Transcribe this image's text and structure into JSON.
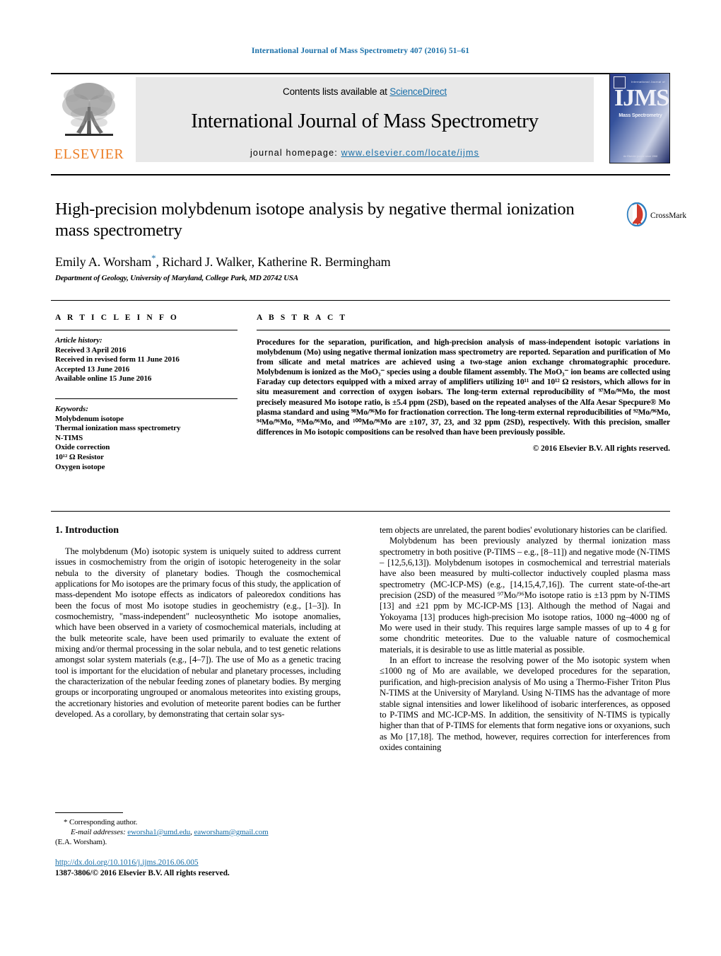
{
  "running_head": "International Journal of Mass Spectrometry 407 (2016) 51–61",
  "masthead": {
    "contents_prefix": "Contents lists available at ",
    "sciencedirect": "ScienceDirect",
    "journal_title": "International Journal of Mass Spectrometry",
    "homepage_label": "journal homepage: ",
    "homepage_url": "www.elsevier.com/locate/ijms",
    "publisher": "ELSEVIER",
    "cover": {
      "acronym": "IJMS",
      "subtitle": "Mass Spectrometry",
      "top_caption": "International Journal of",
      "bottom_caption": "An Elsevier journal since 1968"
    }
  },
  "article": {
    "title": "High-precision molybdenum isotope analysis by negative thermal ionization mass spectrometry",
    "authors": "Emily A. Worsham, Richard J. Walker, Katherine R. Bermingham",
    "author_names": [
      "Emily A. Worsham",
      "Richard J. Walker",
      "Katherine R. Bermingham"
    ],
    "corresponding_marker": "*",
    "affiliation": "Department of Geology, University of Maryland, College Park, MD 20742 USA",
    "crossmark_label": "CrossMark"
  },
  "article_info": {
    "heading": "A R T I C L E    I N F O",
    "history_label": "Article history:",
    "history": [
      "Received 3 April 2016",
      "Received in revised form 11 June 2016",
      "Accepted 13 June 2016",
      "Available online 15 June 2016"
    ],
    "keywords_label": "Keywords:",
    "keywords": [
      "Molybdenum isotope",
      "Thermal ionization mass spectrometry",
      "N-TIMS",
      "Oxide correction",
      "10¹² Ω Resistor",
      "Oxygen isotope"
    ]
  },
  "abstract": {
    "heading": "A B S T R A C T",
    "text": "Procedures for the separation, purification, and high-precision analysis of mass-independent isotopic variations in molybdenum (Mo) using negative thermal ionization mass spectrometry are reported. Separation and purification of Mo from silicate and metal matrices are achieved using a two-stage anion exchange chromatographic procedure. Molybdenum is ionized as the MoO₃⁻ species using a double filament assembly. The MoO₃⁻ ion beams are collected using Faraday cup detectors equipped with a mixed array of amplifiers utilizing 10¹¹ and 10¹² Ω resistors, which allows for in situ measurement and correction of oxygen isobars. The long-term external reproducibility of ⁹⁷Mo/⁹⁶Mo, the most precisely measured Mo isotope ratio, is ±5.4 ppm (2SD), based on the repeated analyses of the Alfa Aesar Specpure® Mo plasma standard and using ⁹⁸Mo/⁹⁶Mo for fractionation correction. The long-term external reproducibilities of ⁹²Mo/⁹⁶Mo, ⁹⁴Mo/⁹⁶Mo, ⁹⁵Mo/⁹⁶Mo, and ¹⁰⁰Mo/⁹⁶Mo are ±107, 37, 23, and 32 ppm (2SD), respectively. With this precision, smaller differences in Mo isotopic compositions can be resolved than have been previously possible.",
    "copyright": "© 2016 Elsevier B.V. All rights reserved."
  },
  "body": {
    "section_number": "1.",
    "section_title": "Introduction",
    "left_paragraphs": [
      "The molybdenum (Mo) isotopic system is uniquely suited to address current issues in cosmochemistry from the origin of isotopic heterogeneity in the solar nebula to the diversity of planetary bodies. Though the cosmochemical applications for Mo isotopes are the primary focus of this study, the application of mass-dependent Mo isotope effects as indicators of paleoredox conditions has been the focus of most Mo isotope studies in geochemistry (e.g., [1–3]). In cosmochemistry, \"mass-independent\" nucleosynthetic Mo isotope anomalies, which have been observed in a variety of cosmochemical materials, including at the bulk meteorite scale, have been used primarily to evaluate the extent of mixing and/or thermal processing in the solar nebula, and to test genetic relations amongst solar system materials (e.g., [4–7]). The use of Mo as a genetic tracing tool is important for the elucidation of nebular and planetary processes, including the characterization of the nebular feeding zones of planetary bodies. By merging groups or incorporating ungrouped or anomalous meteorites into existing groups, the accretionary histories and evolution of meteorite parent bodies can be further developed. As a corollary, by demonstrating that certain solar sys-"
    ],
    "right_paragraphs": [
      "tem objects are unrelated, the parent bodies' evolutionary histories can be clarified.",
      "Molybdenum has been previously analyzed by thermal ionization mass spectrometry in both positive (P-TIMS – e.g., [8–11]) and negative mode (N-TIMS – [12,5,6,13]). Molybdenum isotopes in cosmochemical and terrestrial materials have also been measured by multi-collector inductively coupled plasma mass spectrometry (MC-ICP-MS) (e.g., [14,15,4,7,16]). The current state-of-the-art precision (2SD) of the measured ⁹⁷Mo/⁹⁶Mo isotope ratio is ±13 ppm by N-TIMS [13] and ±21 ppm by MC-ICP-MS [13]. Although the method of Nagai and Yokoyama [13] produces high-precision Mo isotope ratios, 1000 ng–4000 ng of Mo were used in their study. This requires large sample masses of up to 4 g for some chondritic meteorites. Due to the valuable nature of cosmochemical materials, it is desirable to use as little material as possible.",
      "In an effort to increase the resolving power of the Mo isotopic system when ≤1000 ng of Mo are available, we developed procedures for the separation, purification, and high-precision analysis of Mo using a Thermo-Fisher Triton Plus N-TIMS at the University of Maryland. Using N-TIMS has the advantage of more stable signal intensities and lower likelihood of isobaric interferences, as opposed to P-TIMS and MC-ICP-MS. In addition, the sensitivity of N-TIMS is typically higher than that of P-TIMS for elements that form negative ions or oxyanions, such as Mo [17,18]. The method, however, requires correction for interferences from oxides containing"
    ]
  },
  "footnotes": {
    "corresponding": "* Corresponding author.",
    "email_label": "E-mail addresses:",
    "emails": [
      "eworsha1@umd.edu",
      "eaworsham@gmail.com"
    ],
    "email_owner": "(E.A. Worsham).",
    "doi": "http://dx.doi.org/10.1016/j.ijms.2016.06.005",
    "issn_line": "1387-3806/© 2016 Elsevier B.V. All rights reserved."
  },
  "colors": {
    "link": "#1a6fa8",
    "elsevier_orange": "#ec7d24",
    "masthead_bg": "#e8e8e8"
  }
}
